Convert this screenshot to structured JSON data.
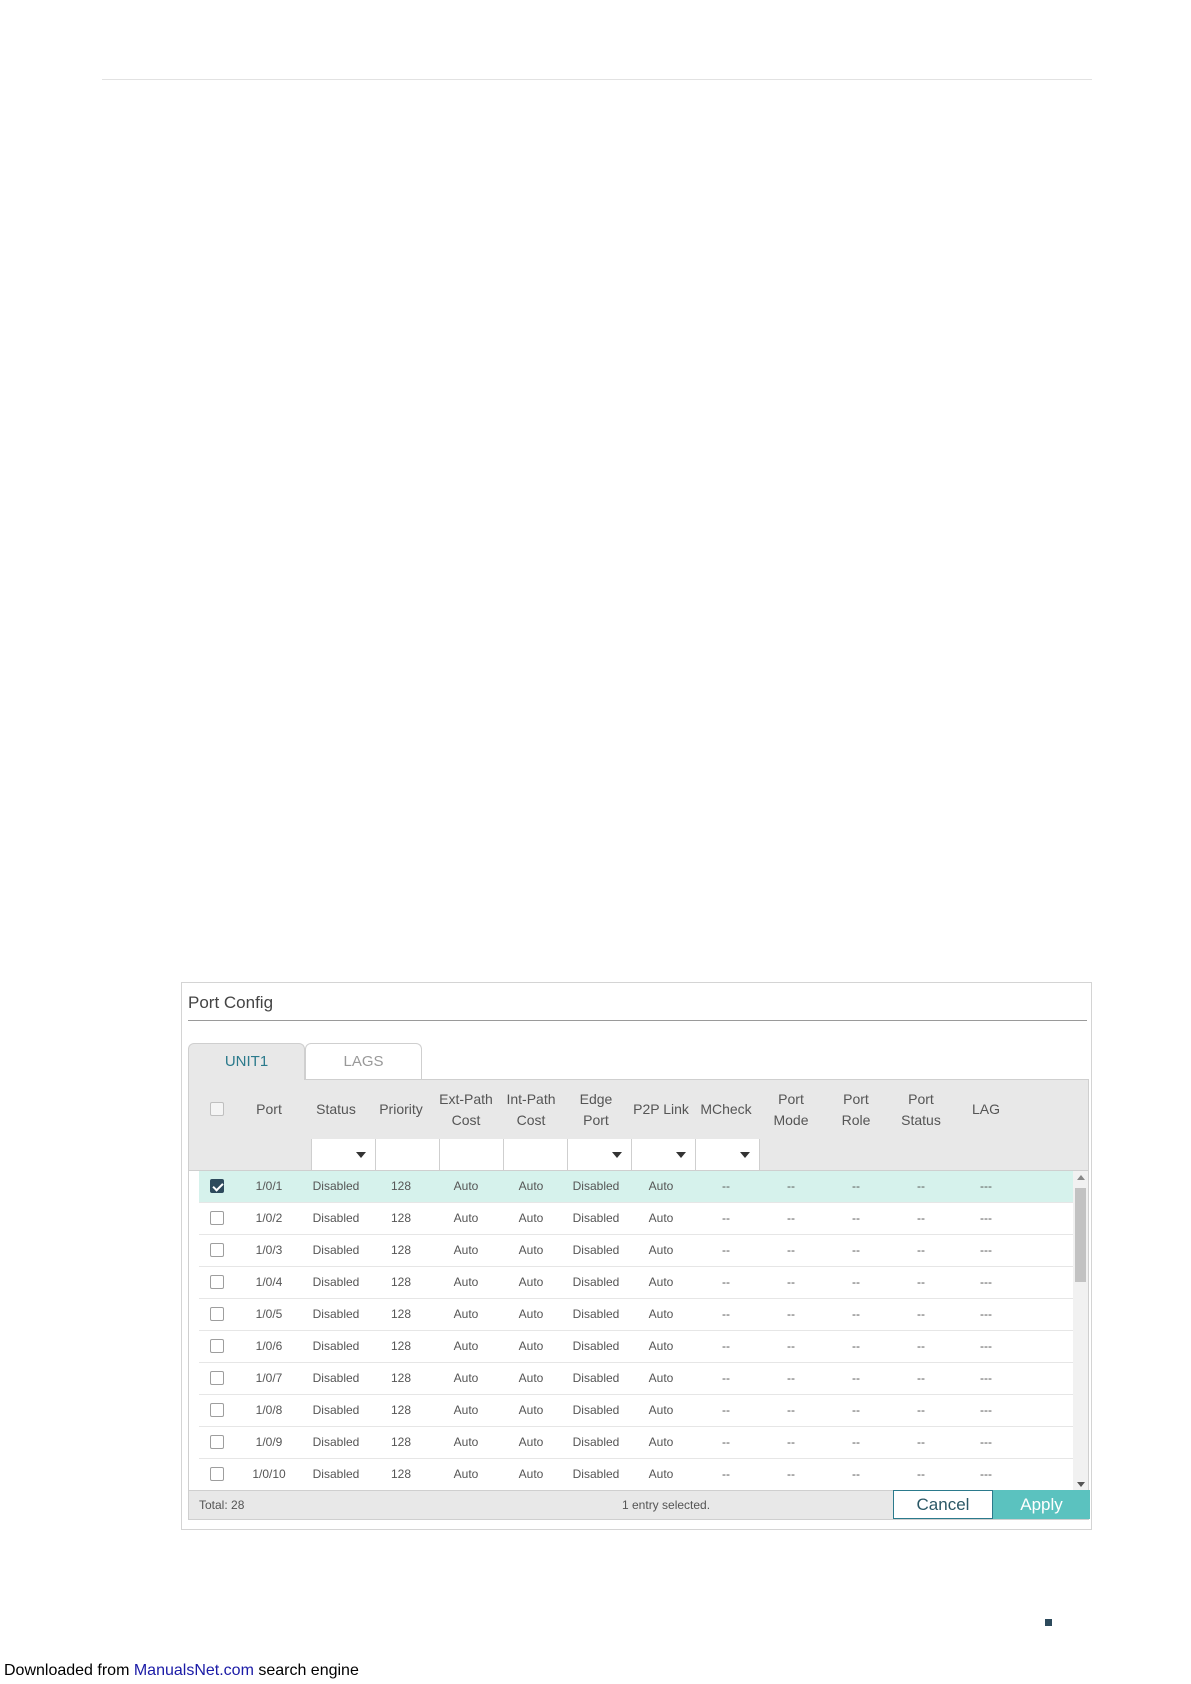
{
  "panel": {
    "title": "Port Config",
    "tabs": [
      {
        "label": "UNIT1",
        "active": true
      },
      {
        "label": "LAGS",
        "active": false
      }
    ]
  },
  "table": {
    "columns": [
      "Port",
      "Status",
      "Priority",
      "Ext-Path\nCost",
      "Int-Path\nCost",
      "Edge\nPort",
      "P2P Link",
      "MCheck",
      "Port\nMode",
      "Port\nRole",
      "Port\nStatus",
      "LAG"
    ],
    "rows": [
      {
        "checked": true,
        "cells": [
          "1/0/1",
          "Disabled",
          "128",
          "Auto",
          "Auto",
          "Disabled",
          "Auto",
          "--",
          "--",
          "--",
          "--",
          "---"
        ]
      },
      {
        "checked": false,
        "cells": [
          "1/0/2",
          "Disabled",
          "128",
          "Auto",
          "Auto",
          "Disabled",
          "Auto",
          "--",
          "--",
          "--",
          "--",
          "---"
        ]
      },
      {
        "checked": false,
        "cells": [
          "1/0/3",
          "Disabled",
          "128",
          "Auto",
          "Auto",
          "Disabled",
          "Auto",
          "--",
          "--",
          "--",
          "--",
          "---"
        ]
      },
      {
        "checked": false,
        "cells": [
          "1/0/4",
          "Disabled",
          "128",
          "Auto",
          "Auto",
          "Disabled",
          "Auto",
          "--",
          "--",
          "--",
          "--",
          "---"
        ]
      },
      {
        "checked": false,
        "cells": [
          "1/0/5",
          "Disabled",
          "128",
          "Auto",
          "Auto",
          "Disabled",
          "Auto",
          "--",
          "--",
          "--",
          "--",
          "---"
        ]
      },
      {
        "checked": false,
        "cells": [
          "1/0/6",
          "Disabled",
          "128",
          "Auto",
          "Auto",
          "Disabled",
          "Auto",
          "--",
          "--",
          "--",
          "--",
          "---"
        ]
      },
      {
        "checked": false,
        "cells": [
          "1/0/7",
          "Disabled",
          "128",
          "Auto",
          "Auto",
          "Disabled",
          "Auto",
          "--",
          "--",
          "--",
          "--",
          "---"
        ]
      },
      {
        "checked": false,
        "cells": [
          "1/0/8",
          "Disabled",
          "128",
          "Auto",
          "Auto",
          "Disabled",
          "Auto",
          "--",
          "--",
          "--",
          "--",
          "---"
        ]
      },
      {
        "checked": false,
        "cells": [
          "1/0/9",
          "Disabled",
          "128",
          "Auto",
          "Auto",
          "Disabled",
          "Auto",
          "--",
          "--",
          "--",
          "--",
          "---"
        ]
      },
      {
        "checked": false,
        "cells": [
          "1/0/10",
          "Disabled",
          "128",
          "Auto",
          "Auto",
          "Disabled",
          "Auto",
          "--",
          "--",
          "--",
          "--",
          "---"
        ]
      }
    ]
  },
  "footer": {
    "total": "Total: 28",
    "selected_info": "1 entry selected.",
    "cancel_label": "Cancel",
    "apply_label": "Apply"
  },
  "download": {
    "prefix": "Downloaded from ",
    "link": "ManualsNet.com",
    "suffix": " search engine"
  },
  "colors": {
    "accent": "#5bc2bf",
    "selected_row": "#d6f2ec",
    "checkbox_checked": "#2d4a5c",
    "tab_text": "#2b7a8c"
  }
}
